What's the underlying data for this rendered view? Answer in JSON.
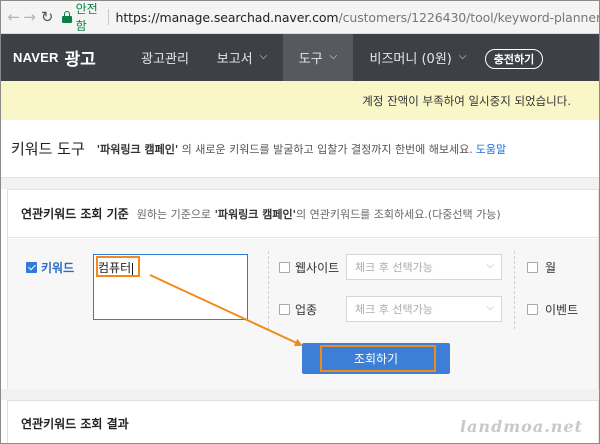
{
  "browser": {
    "secure_label": "안전함",
    "url_host": "https://manage.searchad.naver.com",
    "url_path": "/customers/1226430/tool/keyword-planner"
  },
  "topnav": {
    "brand_naver": "NAVER",
    "brand_ad": "광고",
    "items": [
      {
        "label": "광고관리"
      },
      {
        "label": "보고서"
      },
      {
        "label": "도구"
      },
      {
        "label": "비즈머니 (0원)"
      }
    ],
    "charge_label": "충전하기",
    "active_item": "도구"
  },
  "notice": {
    "text": "계정 잔액이 부족하여 일시중지 되었습니다."
  },
  "page": {
    "title": "키워드 도구",
    "desc_quote": "'파워링크 캠페인'",
    "desc_rest": " 의 새로운 키워드를 발굴하고 입찰가 결정까지 한번에 해보세요.",
    "help": "도움말"
  },
  "criteria": {
    "heading": "연관키워드 조회 기준",
    "desc_pre": "원하는 기준으로 ",
    "desc_quote": "'파워링크 캠페인'",
    "desc_post": "의 연관키워드를 조회하세요.(다중선택 가능)",
    "keyword_label": "키워드",
    "keyword_checked": true,
    "keyword_value": "컴퓨터",
    "website_label": "웹사이트",
    "website_placeholder": "체크 후 선택가능",
    "industry_label": "업종",
    "industry_placeholder": "체크 후 선택가능",
    "month_label": "월",
    "event_label": "이벤트",
    "search_button": "조회하기"
  },
  "results": {
    "heading": "연관키워드 조회 결과"
  },
  "watermark": "landmoa.net",
  "colors": {
    "nav_bg": "#3d4046",
    "notice_bg": "#f9f7c8",
    "accent_blue": "#3d7fd6",
    "highlight_orange": "#f08a1c",
    "secure_green": "#0b8043"
  }
}
